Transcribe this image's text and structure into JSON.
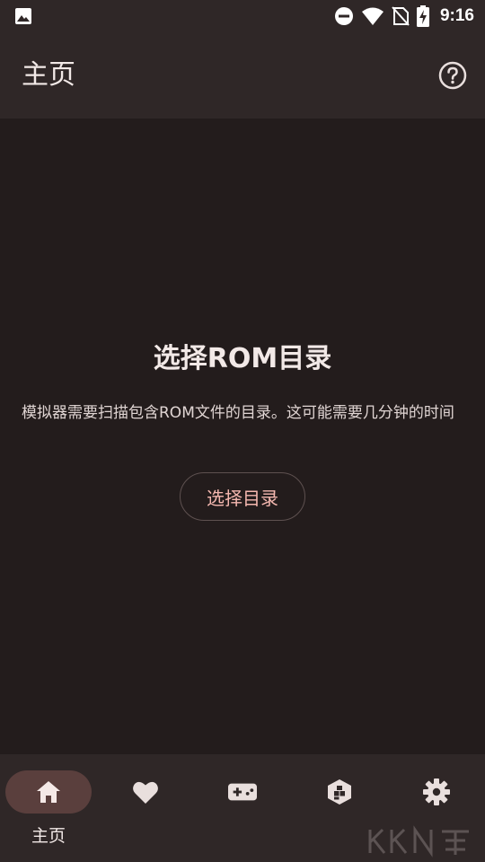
{
  "status_bar": {
    "time": "9:16",
    "icons": [
      "image-icon",
      "do-not-disturb-icon",
      "wifi-icon",
      "no-sim-icon",
      "battery-charging-icon"
    ]
  },
  "app_bar": {
    "title": "主页",
    "help_icon": "help-circle-icon"
  },
  "empty_state": {
    "title": "选择ROM目录",
    "description": "模拟器需要扫描包含ROM文件的目录。这可能需要几分钟的时间",
    "button_label": "选择目录"
  },
  "bottom_nav": {
    "items": [
      {
        "label": "主页",
        "icon": "home-icon",
        "selected": true
      },
      {
        "label": "",
        "icon": "heart-icon",
        "selected": false
      },
      {
        "label": "",
        "icon": "gamepad-icon",
        "selected": false
      },
      {
        "label": "",
        "icon": "cube-icon",
        "selected": false
      },
      {
        "label": "",
        "icon": "gear-icon",
        "selected": false
      }
    ]
  },
  "colors": {
    "background": "#231c1c",
    "bar": "#2f2727",
    "accent": "#f5b8b0",
    "nav_indicator": "#5a3f3d"
  }
}
